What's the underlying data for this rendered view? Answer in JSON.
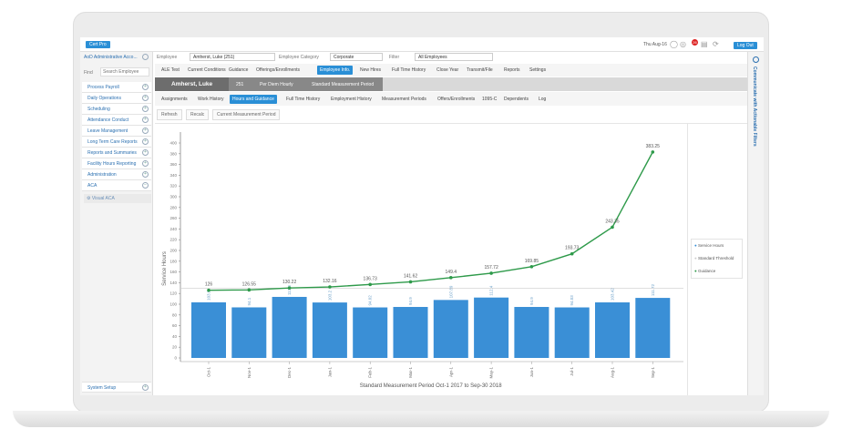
{
  "topbar": {
    "app_button": "Cert Pro",
    "date": "Thu Aug-16",
    "notification_count": "26",
    "logout": "Log Out"
  },
  "sidebar": {
    "account": "AoD Administrative Acco...",
    "find_label": "Find",
    "search_placeholder": "Search Employee",
    "items": [
      {
        "label": "Process Payroll"
      },
      {
        "label": "Daily Operations"
      },
      {
        "label": "Scheduling"
      },
      {
        "label": "Attendance Conduct"
      },
      {
        "label": "Leave Management"
      },
      {
        "label": "Long Term Care Reports"
      },
      {
        "label": "Reports and Summaries"
      },
      {
        "label": "Facility Hours Reporting"
      },
      {
        "label": "Administration"
      },
      {
        "label": "ACA"
      }
    ],
    "sub_item": "Visual ACA",
    "footer": "System Setup"
  },
  "filters": {
    "employee_label": "Employee",
    "employee_value": "Amherst, Luke (251)",
    "category_label": "Employee Category",
    "category_value": "Corporate",
    "filter_label": "Filter",
    "filter_value": "All Employees"
  },
  "tabs": [
    "ALE Test",
    "Current Conditions",
    "Guidance",
    "Offerings/Enrollments",
    "Employee Info.",
    "New Hires",
    "Full Time History",
    "Close Year",
    "Transmit/File",
    "Reports",
    "Settings"
  ],
  "active_tab": "Employee Info.",
  "employee_header": {
    "name": "Amherst, Luke",
    "id": "251",
    "type": "Per Diem Hourly",
    "period": "Standard Measurement Period"
  },
  "subtabs": [
    "Assignments",
    "Work History",
    "Hours and Guidance",
    "Full Time History",
    "Employment History",
    "Measurement Periods",
    "Offers/Enrollments",
    "1095-C",
    "Dependents",
    "Log"
  ],
  "active_subtab": "Hours and Guidance",
  "actions": [
    "Refresh",
    "Recalc",
    "Current Measurement Period"
  ],
  "right_panel": "Communicate with Actionable Filters",
  "chart_data": {
    "type": "bar",
    "xlabel": "Standard Measurement Period Oct-1 2017 to Sep-30 2018",
    "ylabel": "Service Hours",
    "ylim": [
      0,
      400
    ],
    "yticks": [
      0,
      20,
      40,
      60,
      80,
      100,
      120,
      140,
      160,
      180,
      200,
      220,
      240,
      260,
      280,
      300,
      320,
      340,
      360,
      380,
      400
    ],
    "categories": [
      "Oct-1",
      "Nov-1",
      "Dec-1",
      "Jan-1",
      "Feb-1",
      "Mar-1",
      "Apr-1",
      "May-1",
      "Jun-1",
      "Jul-1",
      "Aug-1",
      "Sep-1"
    ],
    "series": [
      {
        "name": "Service Hours",
        "type": "bar",
        "color": "#3a8fd6",
        "values": [
          103.5,
          94.1,
          113.6,
          103.2,
          94.02,
          94.9,
          107.89,
          112.4,
          94.9,
          94.03,
          103.42,
          111.72
        ],
        "labels": [
          "103.5",
          "94.1",
          "113.6",
          "103.2",
          "94.02",
          "94.9",
          "107.89",
          "112.4",
          "94.9",
          "94.03",
          "103.42",
          "111.72"
        ]
      },
      {
        "name": "Standard Threshold",
        "type": "line",
        "color": "#cccccc",
        "value": 130
      },
      {
        "name": "Guidance",
        "type": "line",
        "color": "#2e9a4a",
        "values": [
          126,
          126.55,
          130.22,
          132.16,
          136.73,
          141.62,
          149.4,
          157.72,
          169.85,
          193.73,
          243.35,
          383.25
        ],
        "labels": [
          "126",
          "126.55",
          "130.22",
          "132.16",
          "136.73",
          "141.62",
          "149.4",
          "157.72",
          "169.85",
          "193.73",
          "243.35",
          "383.25"
        ]
      }
    ],
    "legend": "right"
  }
}
